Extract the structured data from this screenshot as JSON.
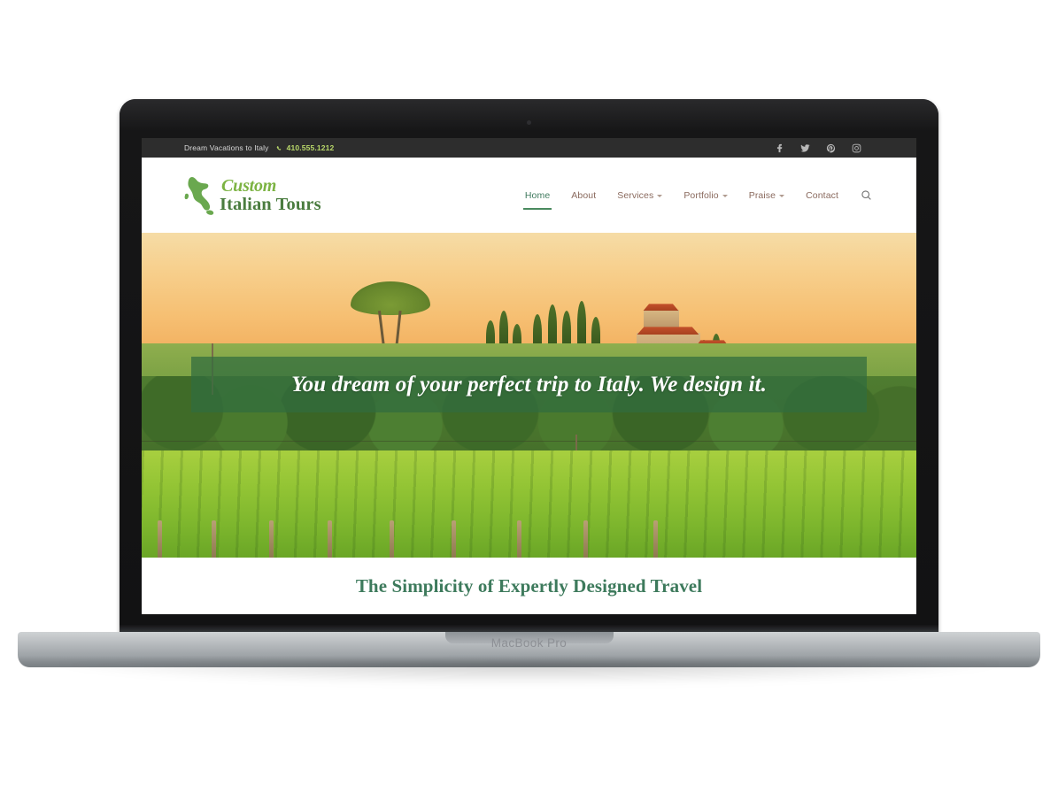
{
  "device": {
    "label": "MacBook Pro"
  },
  "site": {
    "topbar": {
      "tagline": "Dream Vacations to Italy",
      "phone": "410.555.1212",
      "phone_icon": "phone-icon",
      "social": [
        {
          "name": "facebook-icon",
          "label": "Facebook"
        },
        {
          "name": "twitter-icon",
          "label": "Twitter"
        },
        {
          "name": "pinterest-icon",
          "label": "Pinterest"
        },
        {
          "name": "instagram-icon",
          "label": "Instagram"
        }
      ],
      "bg_color": "#2d2d2d",
      "phone_color": "#b9d86a"
    },
    "header": {
      "logo": {
        "line1": "Custom",
        "line2": "Italian Tours",
        "map_icon": "italy-map-icon",
        "line1_color": "#7cb342",
        "line2_color": "#4a7c3f"
      },
      "nav": [
        {
          "label": "Home",
          "active": true,
          "dropdown": false
        },
        {
          "label": "About",
          "active": false,
          "dropdown": false
        },
        {
          "label": "Services",
          "active": false,
          "dropdown": true
        },
        {
          "label": "Portfolio",
          "active": false,
          "dropdown": true
        },
        {
          "label": "Praise",
          "active": false,
          "dropdown": true
        },
        {
          "label": "Contact",
          "active": false,
          "dropdown": false
        }
      ],
      "search_icon": "search-icon",
      "nav_color": "#8a6a5e",
      "active_color": "#3f7a5e"
    },
    "hero": {
      "headline": "You dream of your perfect trip to Italy. We design it.",
      "band_color": "#306c3e",
      "image_alt": "Tuscan hillside with villa, cypress trees and vineyard at sunset"
    },
    "section": {
      "title": "The Simplicity of Expertly Designed Travel",
      "title_color": "#3d7a5c"
    }
  }
}
